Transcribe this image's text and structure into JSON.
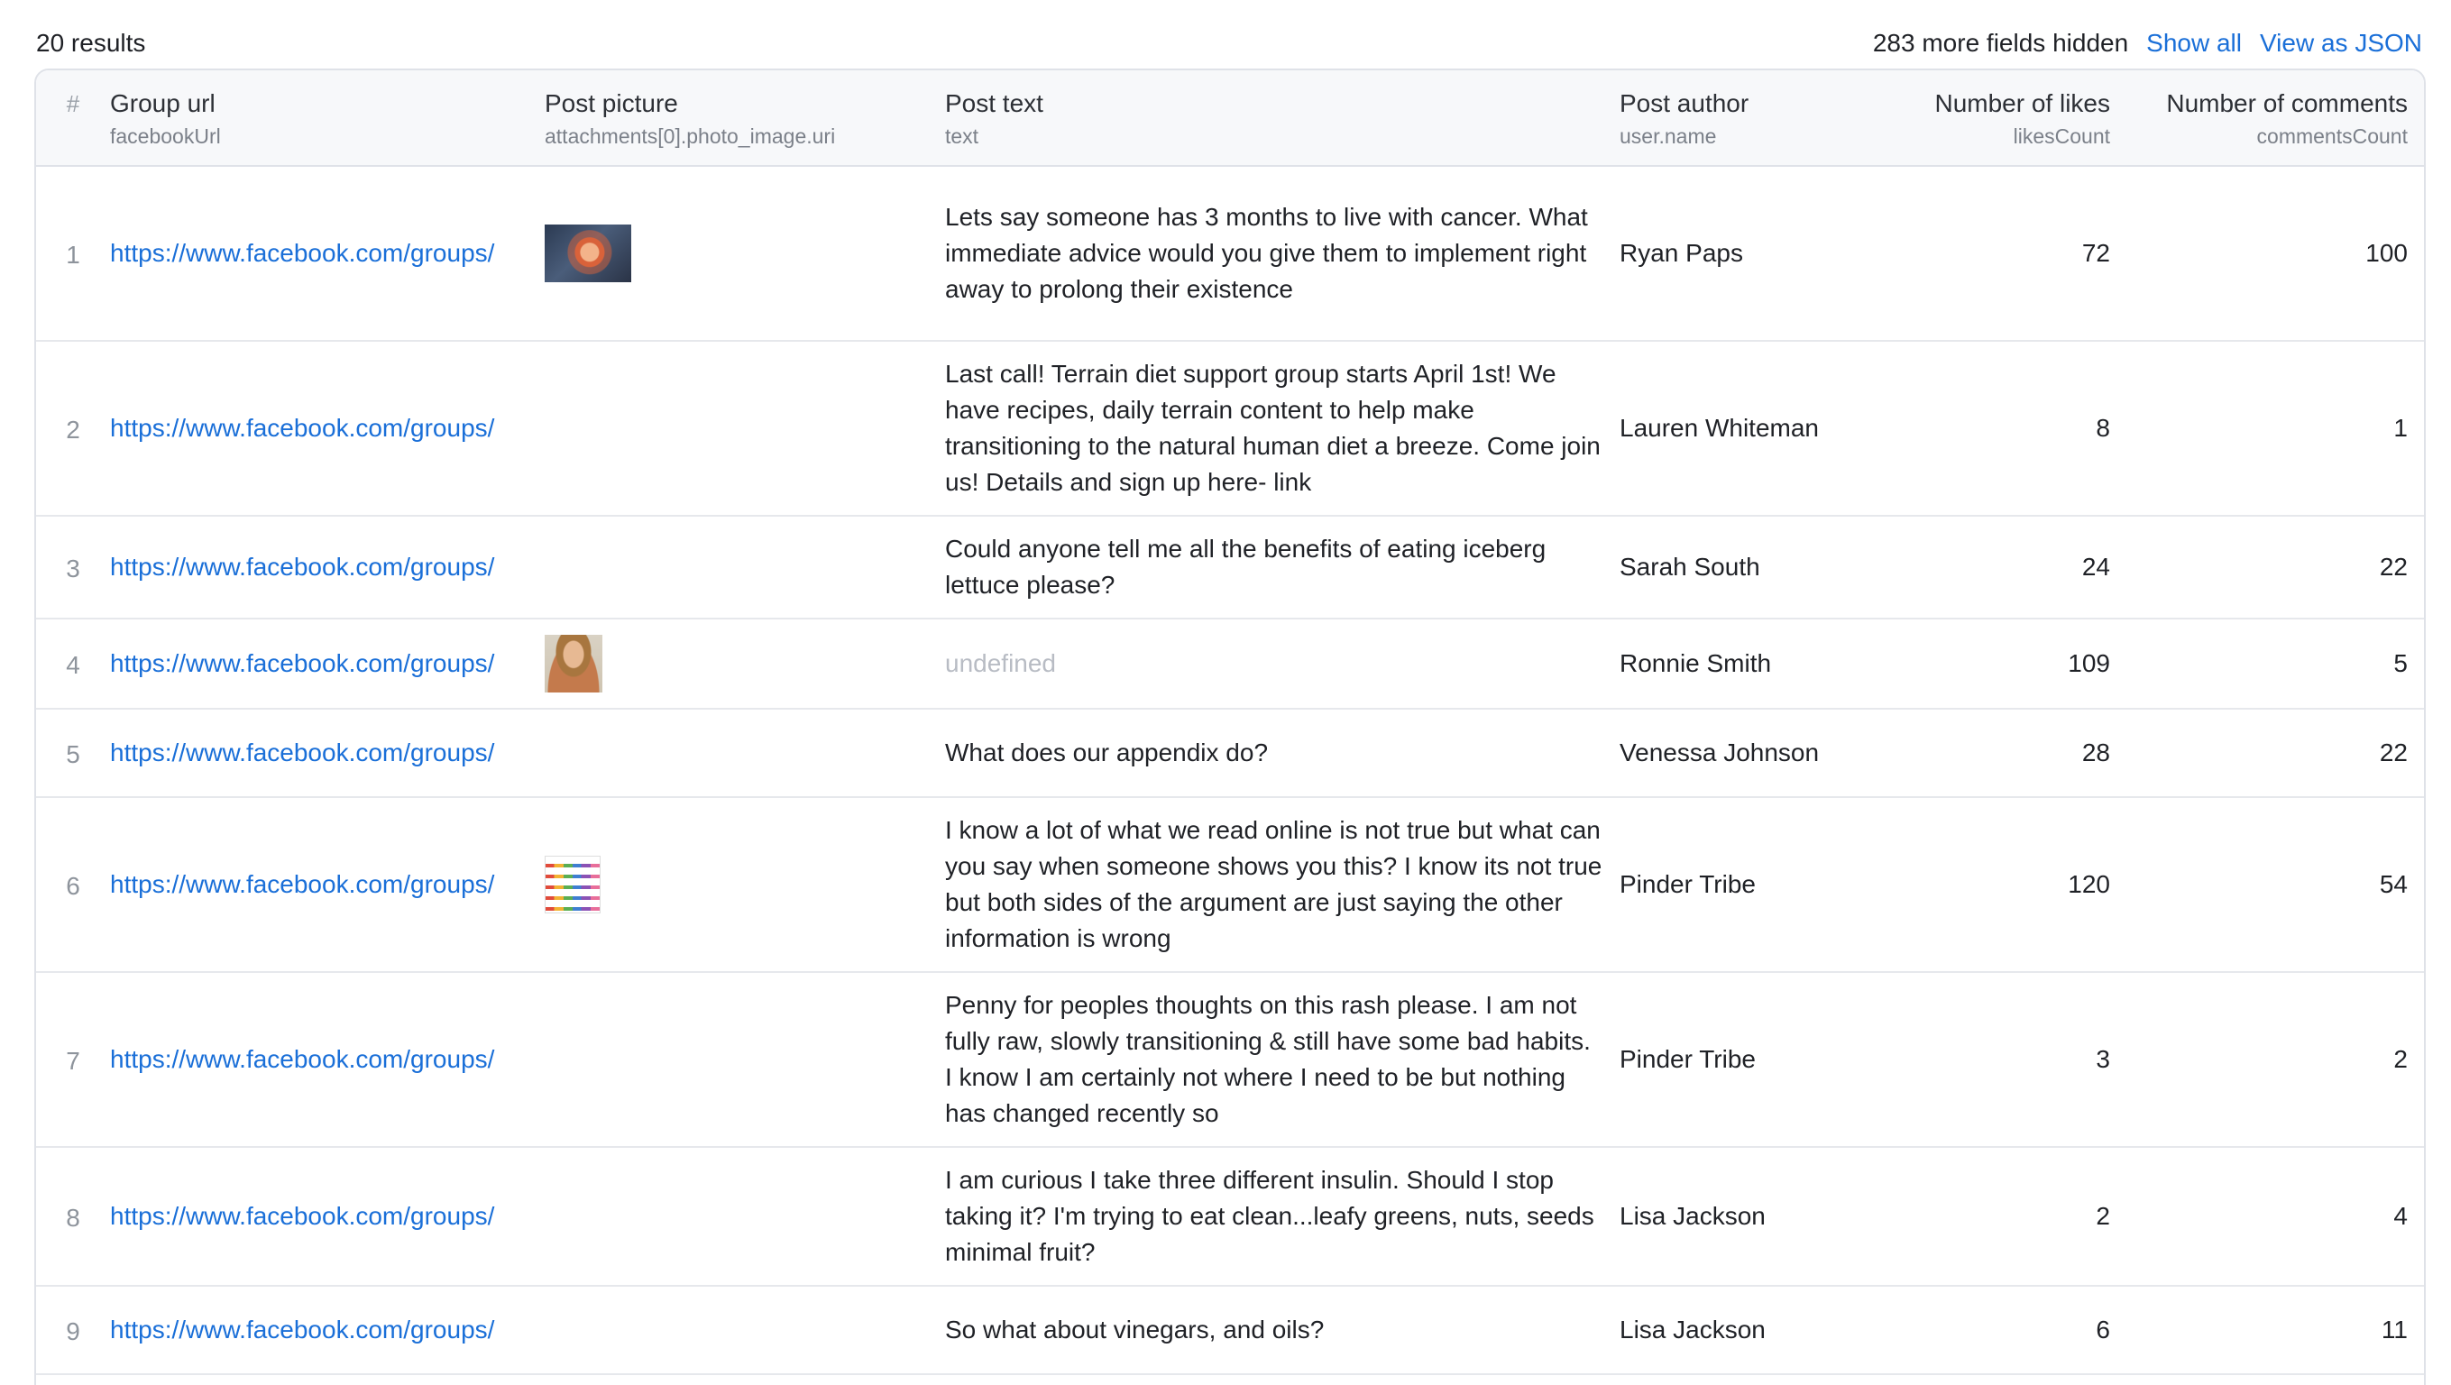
{
  "summary": {
    "results_count": "20 results",
    "hidden_fields": "283 more fields hidden",
    "show_all": "Show all",
    "view_json": "View as JSON"
  },
  "columns": {
    "num": "#",
    "group_url": {
      "label": "Group url",
      "field": "facebookUrl"
    },
    "post_picture": {
      "label": "Post picture",
      "field": "attachments[0].photo_image.uri"
    },
    "post_text": {
      "label": "Post text",
      "field": "text"
    },
    "post_author": {
      "label": "Post author",
      "field": "user.name"
    },
    "likes": {
      "label": "Number of likes",
      "field": "likesCount"
    },
    "comments": {
      "label": "Number of comments",
      "field": "commentsCount"
    }
  },
  "rows": [
    {
      "num": "1",
      "url": "https://www.facebook.com/groups/",
      "picture": "tumor-image-thumbnail",
      "text": "Lets say someone has 3 months to live with cancer. What immediate advice would you give them to implement right away to prolong their existence",
      "author": "Ryan Paps",
      "likes": "72",
      "comments": "100"
    },
    {
      "num": "2",
      "url": "https://www.facebook.com/groups/",
      "picture": "",
      "text": "Last call! Terrain diet support group starts April 1st! We have recipes, daily terrain content to help make transitioning to the natural human diet a breeze. Come join us! Details and sign up here- link",
      "author": "Lauren Whiteman",
      "likes": "8",
      "comments": "1"
    },
    {
      "num": "3",
      "url": "https://www.facebook.com/groups/",
      "picture": "",
      "text": "Could anyone tell me all the benefits of eating iceberg lettuce please?",
      "author": "Sarah South",
      "likes": "24",
      "comments": "22"
    },
    {
      "num": "4",
      "url": "https://www.facebook.com/groups/",
      "picture": "person-photo-thumbnail",
      "text": "undefined",
      "author": "Ronnie Smith",
      "likes": "109",
      "comments": "5"
    },
    {
      "num": "5",
      "url": "https://www.facebook.com/groups/",
      "picture": "",
      "text": "What does our appendix do?",
      "author": "Venessa Johnson",
      "likes": "28",
      "comments": "22"
    },
    {
      "num": "6",
      "url": "https://www.facebook.com/groups/",
      "picture": "chart-image-thumbnail",
      "text": "I know a lot of what we read online is not true but what can you say when someone shows you this? I know its not true but both sides of the argument are just saying the other information is wrong",
      "author": "Pinder Tribe",
      "likes": "120",
      "comments": "54"
    },
    {
      "num": "7",
      "url": "https://www.facebook.com/groups/",
      "picture": "",
      "text": "Penny for peoples thoughts on this rash please. I am not fully raw, slowly transitioning & still have some bad habits. I know I am certainly not where I need to be but nothing has changed recently so",
      "author": "Pinder Tribe",
      "likes": "3",
      "comments": "2"
    },
    {
      "num": "8",
      "url": "https://www.facebook.com/groups/",
      "picture": "",
      "text": "I am curious I take three different insulin. Should I stop taking it? I'm trying to eat clean...leafy greens, nuts, seeds minimal fruit?",
      "author": "Lisa Jackson",
      "likes": "2",
      "comments": "4"
    },
    {
      "num": "9",
      "url": "https://www.facebook.com/groups/",
      "picture": "",
      "text": "So what about vinegars, and oils?",
      "author": "Lisa Jackson",
      "likes": "6",
      "comments": "11"
    }
  ]
}
